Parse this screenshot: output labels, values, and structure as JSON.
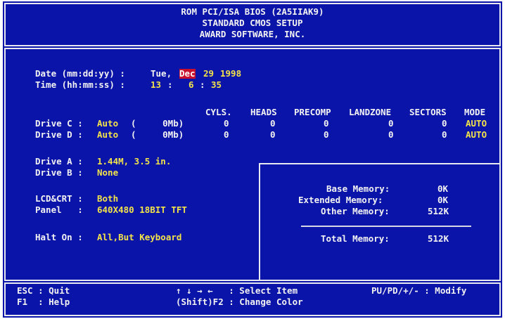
{
  "header": {
    "line1": "ROM PCI/ISA BIOS (2A5IIAK9)",
    "line2": "STANDARD CMOS SETUP",
    "line3": "AWARD SOFTWARE, INC."
  },
  "date": {
    "label": "Date (mm:dd:yy) :",
    "weekday": "Tue,",
    "month": "Dec",
    "day": "29",
    "year": "1998"
  },
  "time": {
    "label": "Time (hh:mm:ss) :",
    "hh": "13",
    "sep1": ":",
    "mm": "6",
    "sep2": ":",
    "ss": "35"
  },
  "drive_table": {
    "headers": [
      "CYLS.",
      "HEADS",
      "PRECOMP",
      "LANDZONE",
      "SECTORS",
      "MODE"
    ],
    "rows": [
      {
        "label": "Drive C :",
        "type": "Auto",
        "size": "(     0Mb)",
        "cyls": "0",
        "heads": "0",
        "precomp": "0",
        "landzone": "0",
        "sectors": "0",
        "mode": "AUTO"
      },
      {
        "label": "Drive D :",
        "type": "Auto",
        "size": "(     0Mb)",
        "cyls": "0",
        "heads": "0",
        "precomp": "0",
        "landzone": "0",
        "sectors": "0",
        "mode": "AUTO"
      }
    ]
  },
  "floppy": {
    "a_label": "Drive A :",
    "a_value": "1.44M, 3.5 in.",
    "b_label": "Drive B :",
    "b_value": "None"
  },
  "display": {
    "lcd_label": "LCD&CRT :",
    "lcd_value": "Both",
    "panel_label": "Panel   :",
    "panel_value": "640X480 18BIT TFT"
  },
  "halt": {
    "label": "Halt On :",
    "value": "All,But Keyboard"
  },
  "memory": {
    "base_label": "Base Memory:",
    "base_value": "0K",
    "ext_label": "Extended Memory:",
    "ext_value": "0K",
    "other_label": "Other Memory:",
    "other_value": "512K",
    "total_label": "Total Memory:",
    "total_value": "512K"
  },
  "footer": {
    "esc": "ESC : Quit",
    "f1": "F1  : Help",
    "arrows": "↑ ↓ → ←   : Select Item",
    "shift": "(Shift)F2 : Change Color",
    "modify": "PU/PD/+/- : Modify"
  },
  "colors": {
    "background": "#0b14a8",
    "label": "#f2f2f2",
    "value": "#f2e34a",
    "highlight": "#c8102e"
  }
}
